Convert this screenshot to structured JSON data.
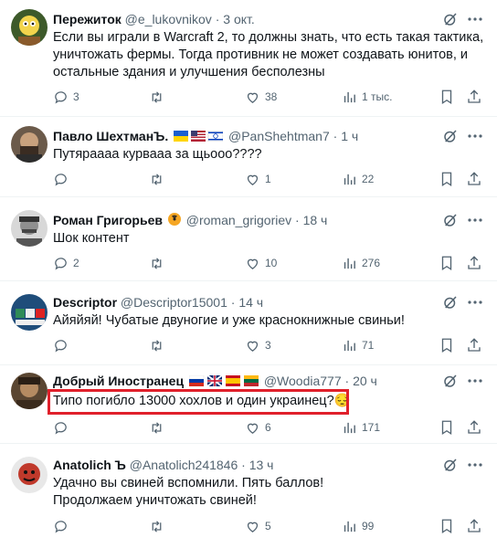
{
  "tweets": [
    {
      "name": "Пережиток",
      "flags": [],
      "handle": "@e_lukovnikov",
      "dot": "·",
      "time": "3 окт.",
      "lines": [
        "Если вы играли в Warcraft 2, то должны знать, что есть такая тактика,",
        "уничтожать фермы. Тогда противник не может создавать юнитов, и",
        "остальные здания и улучшения бесполезны"
      ],
      "replies": "3",
      "retweets": "",
      "likes": "38",
      "views": "1 тыс."
    },
    {
      "name": "Павло ШехтманЪ.",
      "flags": [
        "ua",
        "us",
        "il"
      ],
      "handle": "@PanShehtman7",
      "dot": "·",
      "time": "1 ч",
      "lines": [
        "Путяраааа курвааа за щьооо????"
      ],
      "replies": "",
      "retweets": "",
      "likes": "1",
      "views": "22"
    },
    {
      "name": "Роман Григорьев",
      "flags": [
        "radiation"
      ],
      "handle": "@roman_grigoriev",
      "dot": "·",
      "time": "18 ч",
      "lines": [
        "Шок контент"
      ],
      "replies": "2",
      "retweets": "",
      "likes": "10",
      "views": "276"
    },
    {
      "name": "Descriptor",
      "flags": [],
      "handle": "@Descriptor15001",
      "dot": "·",
      "time": "14 ч",
      "lines": [
        "Айяйяй! Чубатые двуногие и уже краснокнижные свиньи!"
      ],
      "replies": "",
      "retweets": "",
      "likes": "3",
      "views": "71"
    },
    {
      "name": "Добрый Иностранец",
      "flags": [
        "ru",
        "gb",
        "es",
        "lt"
      ],
      "handle": "@Woodia777",
      "dot": "·",
      "time": "20 ч",
      "lines": [
        "Типо погибло 13000 хохлов и один украинец?😔"
      ],
      "replies": "",
      "retweets": "",
      "likes": "6",
      "views": "171"
    },
    {
      "name": "Anatolich Ъ",
      "flags": [],
      "handle": "@Anatolich241846",
      "dot": "·",
      "time": "13 ч",
      "lines": [
        "Удачно вы свиней вспомнили. Пять баллов!",
        "Продолжаем уничтожать свиней!"
      ],
      "replies": "",
      "retweets": "",
      "likes": "5",
      "views": "99"
    }
  ],
  "colors": {
    "text": "#0f1419",
    "muted": "#536471",
    "highlight": "#e0202b"
  },
  "icons": [
    "reply-icon",
    "retweet-icon",
    "like-icon",
    "views-icon",
    "bookmark-icon",
    "share-icon",
    "grok-icon",
    "more-icon"
  ]
}
